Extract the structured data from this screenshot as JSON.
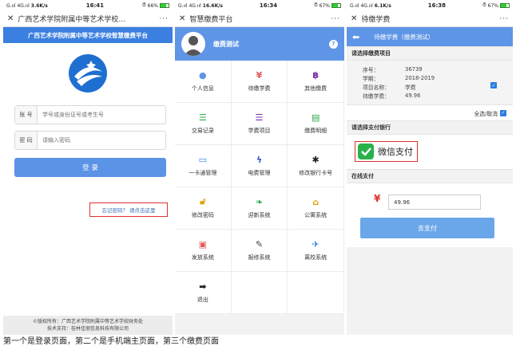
{
  "phone1": {
    "status": {
      "signal": "G.ııl 4G.ııl",
      "speed": "3.6K/s",
      "time": "16:41",
      "icons": "alarm-wifi",
      "battery": "66%"
    },
    "title": "广西艺术学院附属中等艺术学校...",
    "more": "···",
    "banner": "广西艺术学院附属中等艺术学校智慧缴费平台",
    "account_label": "账 号",
    "account_placeholder": "学号或身份证号或考生号",
    "password_label": "密 码",
    "password_placeholder": "请输入密码",
    "login_label": "登 录",
    "forgot_label": "忘记密码？ 请点击这里",
    "footer_line1": "©版权所有：广西艺术学院附属中等艺术学校财务处",
    "footer_line2": "技术支持：桂林佳朋信息科技有限公司",
    "colors": {
      "banner": "#3b7fe0",
      "login": "#5b93e6"
    }
  },
  "phone2": {
    "status": {
      "signal": "G.ııl 4G.ııl",
      "speed": "16.6K/s",
      "time": "16:34",
      "battery": "67%"
    },
    "title": "智慧缴费平台",
    "more": "···",
    "username": "缴费测试",
    "help": "?",
    "menu": [
      {
        "label": "个人信息",
        "icon": "person-icon",
        "glyph": "●",
        "color": "#5f95e6"
      },
      {
        "label": "待缴学费",
        "icon": "yen-icon",
        "glyph": "¥",
        "color": "#e05a5a"
      },
      {
        "label": "其他缴费",
        "icon": "bitcoin-icon",
        "glyph": "฿",
        "color": "#7a2aa8"
      },
      {
        "label": "交易记录",
        "icon": "list-icon",
        "glyph": "☰",
        "color": "#2aa84a"
      },
      {
        "label": "学费项目",
        "icon": "menu-icon",
        "glyph": "☰",
        "color": "#7a2aa8"
      },
      {
        "label": "缴费明细",
        "icon": "receipt-icon",
        "glyph": "▤",
        "color": "#2aa84a"
      },
      {
        "label": "一卡通管理",
        "icon": "card-icon",
        "glyph": "▭",
        "color": "#2a7de1"
      },
      {
        "label": "电费管理",
        "icon": "bolt-icon",
        "glyph": "ϟ",
        "color": "#2a4ed6"
      },
      {
        "label": "修改银行卡号",
        "icon": "gear-icon",
        "glyph": "✱",
        "color": "#222222"
      },
      {
        "label": "修改密码",
        "icon": "unlock-icon",
        "glyph": "🔓︎",
        "color": "#e0a000"
      },
      {
        "label": "迎新系统",
        "icon": "leaf-icon",
        "glyph": "❧",
        "color": "#2aa84a"
      },
      {
        "label": "公寓系统",
        "icon": "building-icon",
        "glyph": "⌂",
        "color": "#e0a000"
      },
      {
        "label": "发放系统",
        "icon": "money-icon",
        "glyph": "▣",
        "color": "#e05a5a"
      },
      {
        "label": "报修系统",
        "icon": "wrench-icon",
        "glyph": "✎",
        "color": "#444444"
      },
      {
        "label": "离校系统",
        "icon": "plane-icon",
        "glyph": "✈",
        "color": "#2a7de1"
      },
      {
        "label": "退出",
        "icon": "logout-icon",
        "glyph": "➡",
        "color": "#222222"
      }
    ],
    "colors": {
      "userbar": "#5f95e6"
    }
  },
  "phone3": {
    "status": {
      "signal": "G.ııl 4G.ııl",
      "speed": "6.1K/s",
      "time": "16:38",
      "battery": "67%"
    },
    "title": "待缴学费",
    "more": "···",
    "subtitle": "待缴学费（缴费测试）",
    "section_items": "请选择缴费项目",
    "fields": [
      {
        "key": "序号：",
        "value": "36739"
      },
      {
        "key": "学期：",
        "value": "2018-2019"
      },
      {
        "key": "项目名称：",
        "value": "学费"
      },
      {
        "key": "待缴学费：",
        "value": "49.96"
      }
    ],
    "select_all": "全选/取消",
    "section_bank": "请选择支付银行",
    "wechat_label": "微信支付",
    "section_online": "在线支付",
    "currency": "¥",
    "amount": "49.96",
    "pay_label": "去支付",
    "colors": {
      "head": "#5f95e6",
      "pay": "#6aa7ea",
      "wechat": "#2ab24a"
    }
  },
  "caption": "第一个是登录页面，第二个是手机端主页面，第三个缴费页面"
}
